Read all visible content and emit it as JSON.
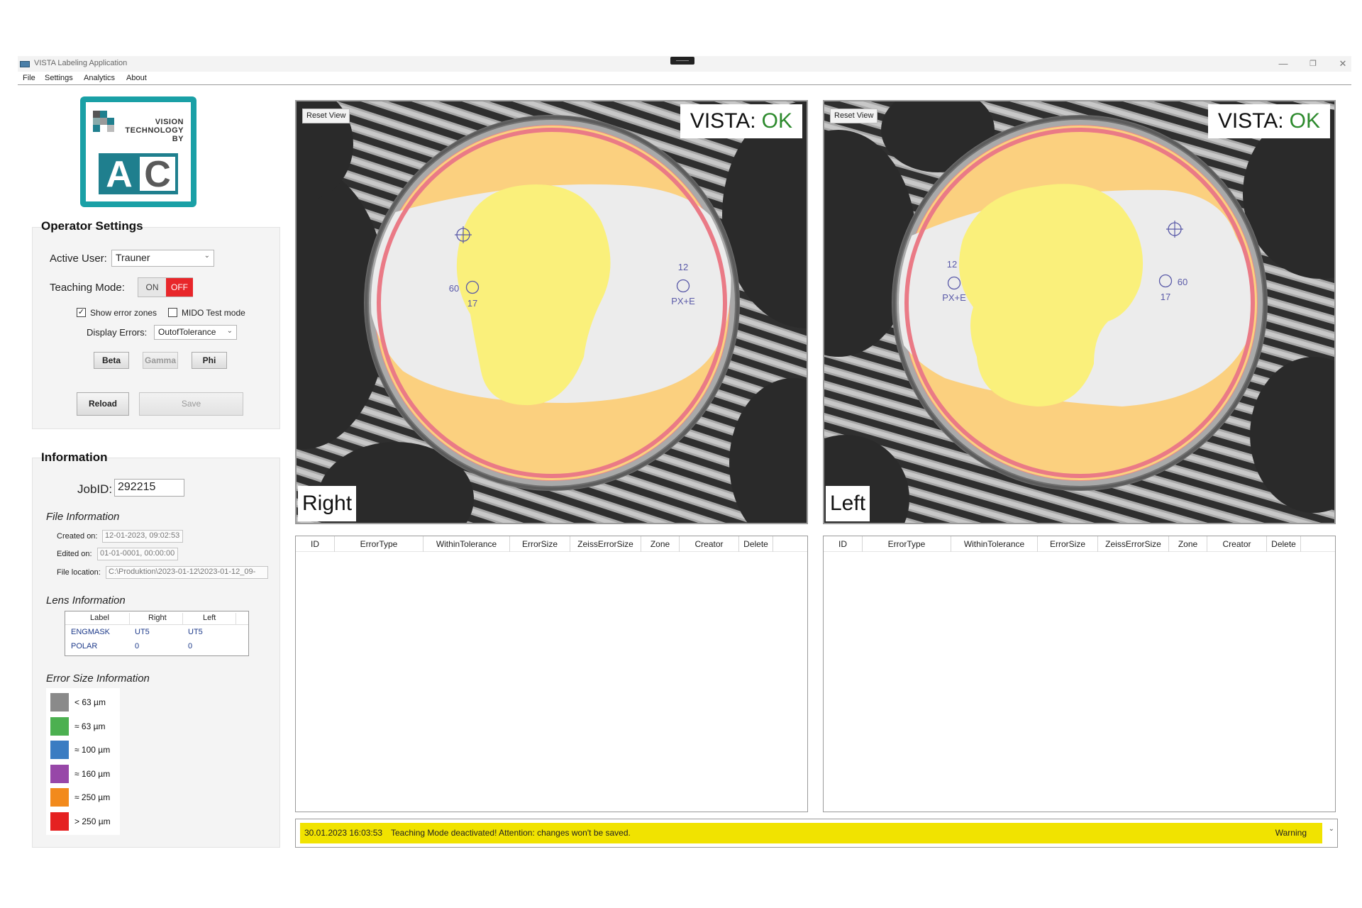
{
  "window": {
    "title": "VISTA Labeling Application",
    "minimize": "—",
    "restore": "❐",
    "close": "✕"
  },
  "menu": [
    "File",
    "Settings",
    "Analytics",
    "About"
  ],
  "logo": {
    "line1": "VISION",
    "line2": "TECHNOLOGY",
    "line3": "BY",
    "letter1": "A",
    "letter2": "C",
    "brand_color": "#1aa0a6"
  },
  "operator": {
    "title": "Operator Settings",
    "active_user_label": "Active User:",
    "active_user_value": "Trauner",
    "teaching_label": "Teaching Mode:",
    "toggle_on": "ON",
    "toggle_off": "OFF",
    "toggle_state": "OFF",
    "show_error_zones_label": "Show error zones",
    "show_error_zones_checked": true,
    "mido_label": "MIDO Test mode",
    "mido_checked": false,
    "display_errors_label": "Display Errors:",
    "display_errors_value": "OutofTolerance",
    "beta": "Beta",
    "gamma": "Gamma",
    "phi": "Phi",
    "reload": "Reload",
    "save": "Save"
  },
  "information": {
    "title": "Information",
    "jobid_label": "JobID:",
    "jobid_value": "292215",
    "file_info_title": "File Information",
    "created_label": "Created on:",
    "created_value": "12-01-2023, 09:02:53",
    "edited_label": "Edited on:",
    "edited_value": "01-01-0001, 00:00:00",
    "location_label": "File location:",
    "location_value": "C:\\Produktion\\2023-01-12\\2023-01-12_09-",
    "lens_info_title": "Lens Information",
    "lens_table": {
      "headers": [
        "Label",
        "Right",
        "Left"
      ],
      "rows": [
        [
          "ENGMASK",
          "UT5",
          "UT5"
        ],
        [
          "POLAR",
          "0",
          "0"
        ]
      ]
    },
    "error_size_title": "Error Size Information",
    "error_sizes": [
      {
        "color": "#8a8a8a",
        "label": "<   63 µm"
      },
      {
        "color": "#4cb050",
        "label": "≈   63 µm"
      },
      {
        "color": "#3a7cc2",
        "label": "≈ 100 µm"
      },
      {
        "color": "#9747a8",
        "label": "≈ 160 µm"
      },
      {
        "color": "#f28a1c",
        "label": "≈ 250 µm"
      },
      {
        "color": "#e52121",
        "label": "> 250 µm"
      }
    ]
  },
  "panels": {
    "right": {
      "reset_label": "Reset View",
      "vista_label": "VISTA:",
      "vista_status": "OK",
      "side_label": "Right",
      "marks": {
        "left_num": "60",
        "left_sub": "17",
        "right_num": "12",
        "right_sub": "PX+E"
      }
    },
    "left": {
      "reset_label": "Reset View",
      "vista_label": "VISTA:",
      "vista_status": "OK",
      "side_label": "Left",
      "marks": {
        "left_num": "12",
        "left_sub": "PX+E",
        "right_num": "60",
        "right_sub": "17"
      }
    }
  },
  "error_table": {
    "columns": [
      "ID",
      "ErrorType",
      "WithinTolerance",
      "ErrorSize",
      "ZeissErrorSize",
      "Zone",
      "Creator",
      "Delete"
    ]
  },
  "status": {
    "time": "30.01.2023 16:03:53",
    "message": "Teaching Mode deactivated! Attention: changes won't be saved.",
    "level": "Warning",
    "color": "#f1e300"
  },
  "colors": {
    "ok_green": "#2d8a2d",
    "toggle_off_red": "#e8262a"
  }
}
